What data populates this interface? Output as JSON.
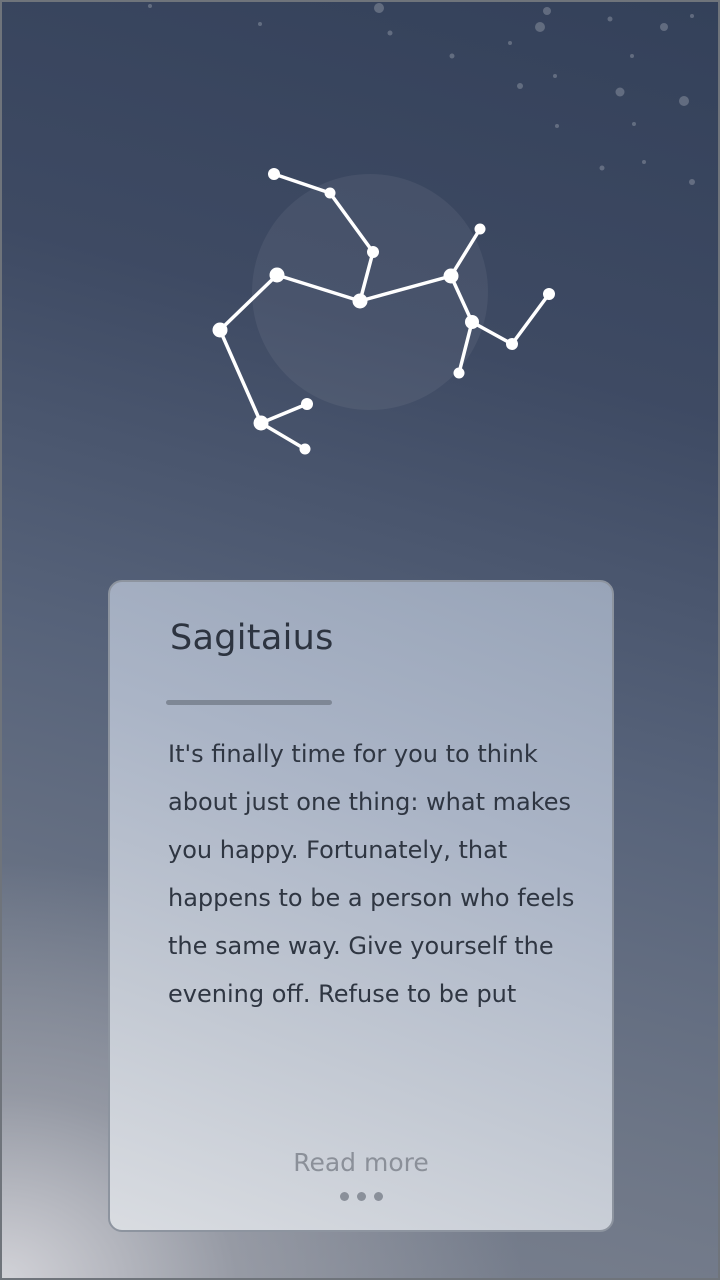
{
  "sign": {
    "name": "Sagitaius",
    "horoscope": "It's finally time for you to think about just one thing: what makes you happy. Fortunately, that happens to be a person who feels the same way. Give yourself the evening off. Refuse to be put",
    "read_more_label": "Read more",
    "constellation_icon": "sagittarius-constellation"
  },
  "theme": {
    "background_top": "#34415a",
    "background_bottom": "#7d8390",
    "card_background": "#aab4c6",
    "text_color": "#2f3642",
    "star_color": "#ffffff"
  }
}
